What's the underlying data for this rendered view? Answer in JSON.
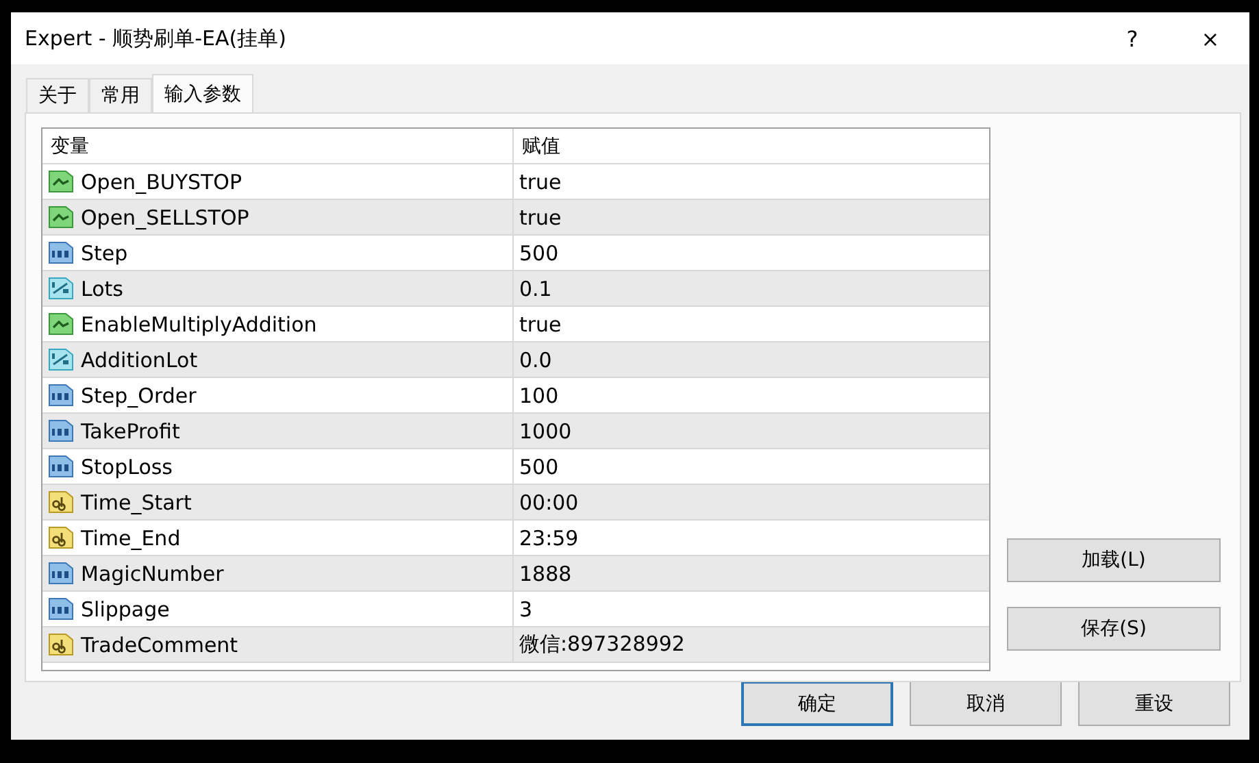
{
  "window": {
    "title": "Expert - 顺势刷单-EA(挂单)",
    "help": "?",
    "close": "×"
  },
  "tabs": [
    {
      "label": "关于",
      "selected": false
    },
    {
      "label": "常用",
      "selected": false
    },
    {
      "label": "输入参数",
      "selected": true
    }
  ],
  "table": {
    "columns": [
      "变量",
      "赋值"
    ],
    "rows": [
      {
        "kind": "bool",
        "name": "Open_BUYSTOP",
        "value": "true"
      },
      {
        "kind": "bool",
        "name": "Open_SELLSTOP",
        "value": "true"
      },
      {
        "kind": "int",
        "name": "Step",
        "value": "500"
      },
      {
        "kind": "double",
        "name": "Lots",
        "value": "0.1"
      },
      {
        "kind": "bool",
        "name": "EnableMultiplyAddition",
        "value": "true"
      },
      {
        "kind": "double",
        "name": "AdditionLot",
        "value": "0.0"
      },
      {
        "kind": "int",
        "name": "Step_Order",
        "value": "100"
      },
      {
        "kind": "int",
        "name": "TakeProfit",
        "value": "1000"
      },
      {
        "kind": "int",
        "name": "StopLoss",
        "value": "500"
      },
      {
        "kind": "string",
        "name": "Time_Start",
        "value": "00:00"
      },
      {
        "kind": "string",
        "name": "Time_End",
        "value": "23:59"
      },
      {
        "kind": "int",
        "name": "MagicNumber",
        "value": "1888"
      },
      {
        "kind": "int",
        "name": "Slippage",
        "value": "3"
      },
      {
        "kind": "string",
        "name": "TradeComment",
        "value": "微信:897328992"
      }
    ]
  },
  "side_buttons": [
    "加载(L)",
    "保存(S)"
  ],
  "buttons": [
    {
      "label": "确定",
      "focused": true
    },
    {
      "label": "取消",
      "focused": false
    },
    {
      "label": "重设",
      "focused": false
    }
  ]
}
